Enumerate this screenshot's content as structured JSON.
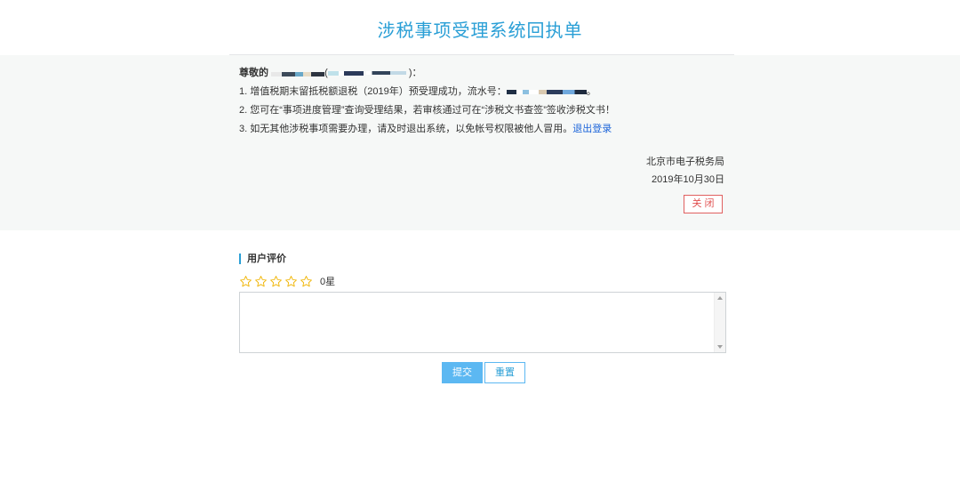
{
  "header": {
    "title": "涉税事项受理系统回执单"
  },
  "receipt": {
    "greeting_prefix": "尊敬的",
    "greeting_open": "(",
    "greeting_close": ")：",
    "line1_text": "1. 增值税期末留抵税额退税（2019年）预受理成功，流水号：",
    "line1_end": "。",
    "line2_text": "2. 您可在“事项进度管理”查询受理结果，若审核通过可在“涉税文书查签”签收涉税文书！",
    "line3_text": "3. 如无其他涉税事项需要办理，请及时退出系统，以免帐号权限被他人冒用。",
    "logout_link": "退出登录",
    "signature_org": "北京市电子税务局",
    "signature_date": "2019年10月30日",
    "close_label": "关 闭"
  },
  "rating": {
    "section_title": "用户评价",
    "stars_max": 5,
    "stars_value": 0,
    "value_label": "0星"
  },
  "comment": {
    "value": ""
  },
  "actions": {
    "submit_label": "提交",
    "reset_label": "重置"
  },
  "colors": {
    "accent": "#2a9fd6",
    "danger": "#e05050",
    "button": "#5cb8f2",
    "star": "#f0b400"
  }
}
